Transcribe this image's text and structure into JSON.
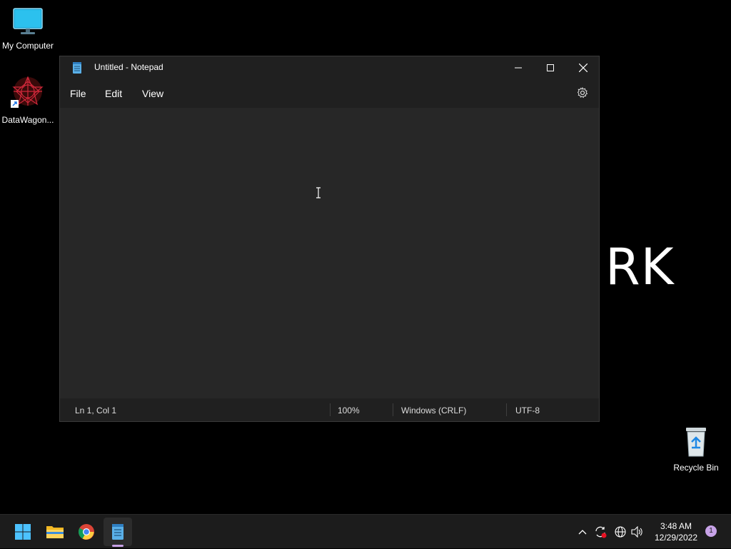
{
  "desktop": {
    "icons": [
      {
        "label": "My Computer"
      },
      {
        "label": "DataWagon..."
      },
      {
        "label": "Recycle Bin"
      }
    ],
    "wallpaper_text": "RK"
  },
  "notepad": {
    "title": "Untitled - Notepad",
    "menu": [
      "File",
      "Edit",
      "View"
    ],
    "editor_text": "",
    "status": {
      "position": "Ln 1, Col 1",
      "zoom": "100%",
      "line_endings": "Windows (CRLF)",
      "encoding": "UTF-8"
    }
  },
  "taskbar": {
    "apps": [
      "start",
      "file-explorer",
      "chrome",
      "notepad"
    ],
    "active_app": "notepad",
    "clock": {
      "time": "3:48 AM",
      "date": "12/29/2022"
    },
    "notification_count": "1"
  },
  "colors": {
    "window_bg": "#202020",
    "editor_bg": "#272727",
    "taskbar_bg": "#1c1c1c",
    "accent": "#c7a1e6"
  }
}
